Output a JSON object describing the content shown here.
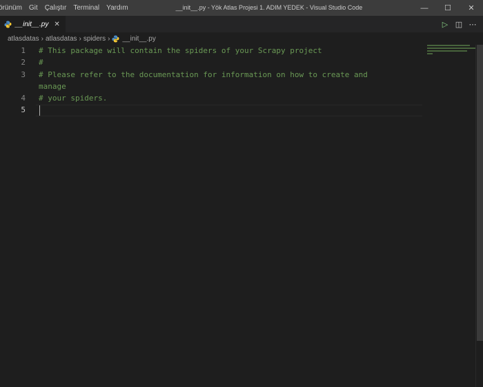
{
  "menu": [
    "örünüm",
    "Git",
    "Çalıştır",
    "Terminal",
    "Yardım"
  ],
  "window_title": "__init__.py - Yök Atlas Projesi 1. ADIM YEDEK - Visual Studio Code",
  "window_controls": {
    "minimize": "—",
    "maximize": "☐",
    "close": "✕"
  },
  "tab": {
    "label": "__init__.py",
    "close": "✕",
    "icon": "python-icon"
  },
  "editor_actions": {
    "run": "▷",
    "split": "◫",
    "more": "⋯"
  },
  "breadcrumb": {
    "items": [
      "atlasdatas",
      "atlasdatas",
      "spiders"
    ],
    "separator": "›",
    "file": "__init__.py"
  },
  "code_lines": [
    {
      "num": "1",
      "text": "# This package will contain the spiders of your Scrapy project"
    },
    {
      "num": "2",
      "text": "#"
    },
    {
      "num": "3",
      "text": "# Please refer to the documentation for information on how to create and"
    },
    {
      "num": "",
      "text": "manage"
    },
    {
      "num": "4",
      "text": "# your spiders."
    },
    {
      "num": "5",
      "text": ""
    }
  ],
  "colors": {
    "comment": "#6a9955",
    "background": "#1e1e1e",
    "titlebar": "#3c3c3c"
  }
}
